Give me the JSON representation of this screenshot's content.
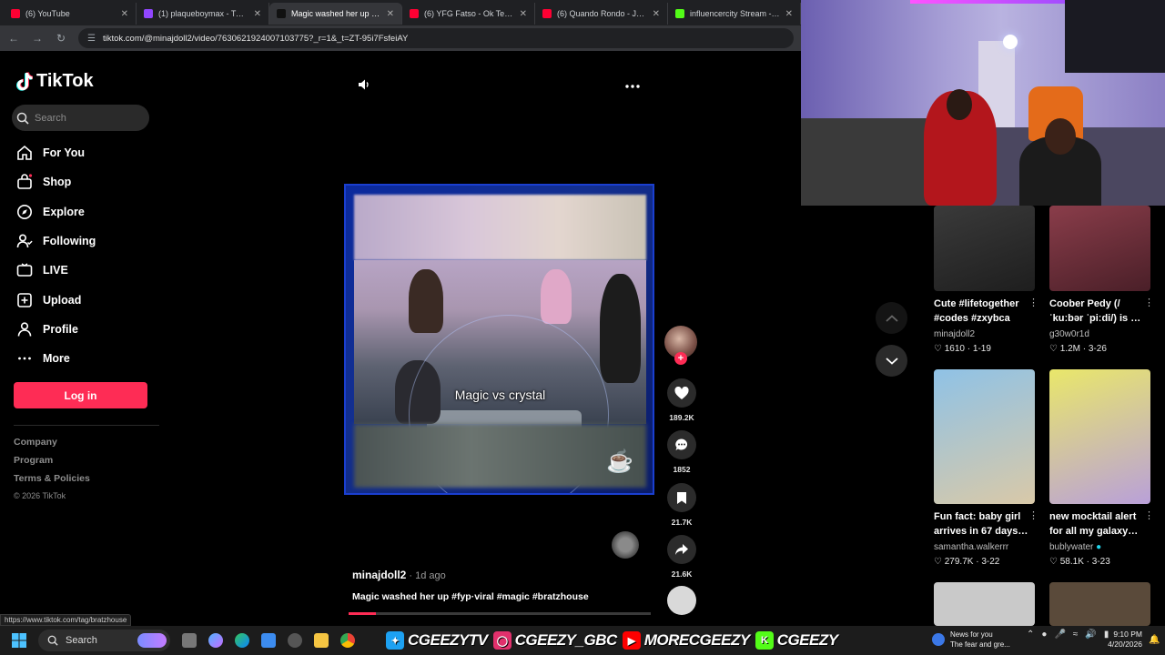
{
  "browser": {
    "tabs": [
      {
        "label": "(6) YouTube",
        "color": "#ff0033"
      },
      {
        "label": "(1) plaqueboymax - Twitch",
        "color": "#9146ff"
      },
      {
        "label": "Magic washed her up #fyp…",
        "color": "#111111",
        "active": true
      },
      {
        "label": "(6) YFG Fatso - Ok Teaze (Of",
        "color": "#ff0033"
      },
      {
        "label": "(6) Quando Rondo - Jakiyah",
        "color": "#ff0033"
      },
      {
        "label": "influencercity Stream - Watc",
        "color": "#53fc18"
      }
    ],
    "url": "tiktok.com/@minajdoll2/video/7630621924007103775?_r=1&_t=ZT-95i7FsfeiAY"
  },
  "sidebar": {
    "logo": "TikTok",
    "search_placeholder": "Search",
    "nav": [
      {
        "label": "For You",
        "icon": "home-icon"
      },
      {
        "label": "Shop",
        "icon": "shop-icon"
      },
      {
        "label": "Explore",
        "icon": "compass-icon"
      },
      {
        "label": "Following",
        "icon": "following-icon"
      },
      {
        "label": "LIVE",
        "icon": "live-icon"
      },
      {
        "label": "Upload",
        "icon": "upload-icon"
      },
      {
        "label": "Profile",
        "icon": "profile-icon"
      },
      {
        "label": "More",
        "icon": "more-icon"
      }
    ],
    "login": "Log in",
    "footer": [
      "Company",
      "Program",
      "Terms & Policies"
    ],
    "copyright": "© 2026 TikTok"
  },
  "video": {
    "caption_overlay": "Magic vs crystal",
    "author": "minajdoll2",
    "age": " · 1d ago",
    "description": "Magic washed her up #fyp·viral #magic #bratzhouse",
    "progress": 0.09
  },
  "actions": {
    "likes": "189.2K",
    "comments": "1852",
    "saves": "21.7K",
    "shares": "21.6K"
  },
  "recommendations": [
    {
      "title": "Cute #lifetogether #codes #zxybca",
      "user": "minajdoll2",
      "likes": "1610",
      "date": "1-19",
      "verified": false,
      "colors": [
        "#3a3a3a",
        "#1e1e1e"
      ]
    },
    {
      "title": "Coober Pedy (/ ˈkuːbər ˈpiːdi/) is …",
      "user": "g30w0r1d",
      "likes": "1.2M",
      "date": "3-26",
      "verified": false,
      "colors": [
        "#8a3d4a",
        "#4a1f28"
      ]
    },
    {
      "title": "Fun fact: baby girl arrives in 67 days…",
      "user": "samantha.walkerrr",
      "likes": "279.7K",
      "date": "3-22",
      "verified": false,
      "colors": [
        "#8fc2e6",
        "#d9c9a8"
      ]
    },
    {
      "title": "new mocktail alert for all my galaxy…",
      "user": "bublywater",
      "likes": "58.1K",
      "date": "3-23",
      "verified": true,
      "colors": [
        "#e9e76a",
        "#b9a0d9"
      ]
    }
  ],
  "status_url": "https://www.tiktok.com/tag/bratzhouse",
  "taskbar": {
    "search": "Search",
    "socials": [
      {
        "handle": "CGEEZYTV",
        "icon": "twitter-icon",
        "color": "#1da1f2"
      },
      {
        "handle": "CGEEZY_GBC",
        "icon": "instagram-icon",
        "color": "#e1306c"
      },
      {
        "handle": "MORECGEEZY",
        "icon": "youtube-icon",
        "color": "#ff0000"
      },
      {
        "handle": "CGEEZY",
        "icon": "kick-icon",
        "color": "#53fc18"
      }
    ],
    "news_title": "News for you",
    "news_sub": "The fear and gre...",
    "time": "9:10 PM",
    "date": "4/20/2026"
  }
}
